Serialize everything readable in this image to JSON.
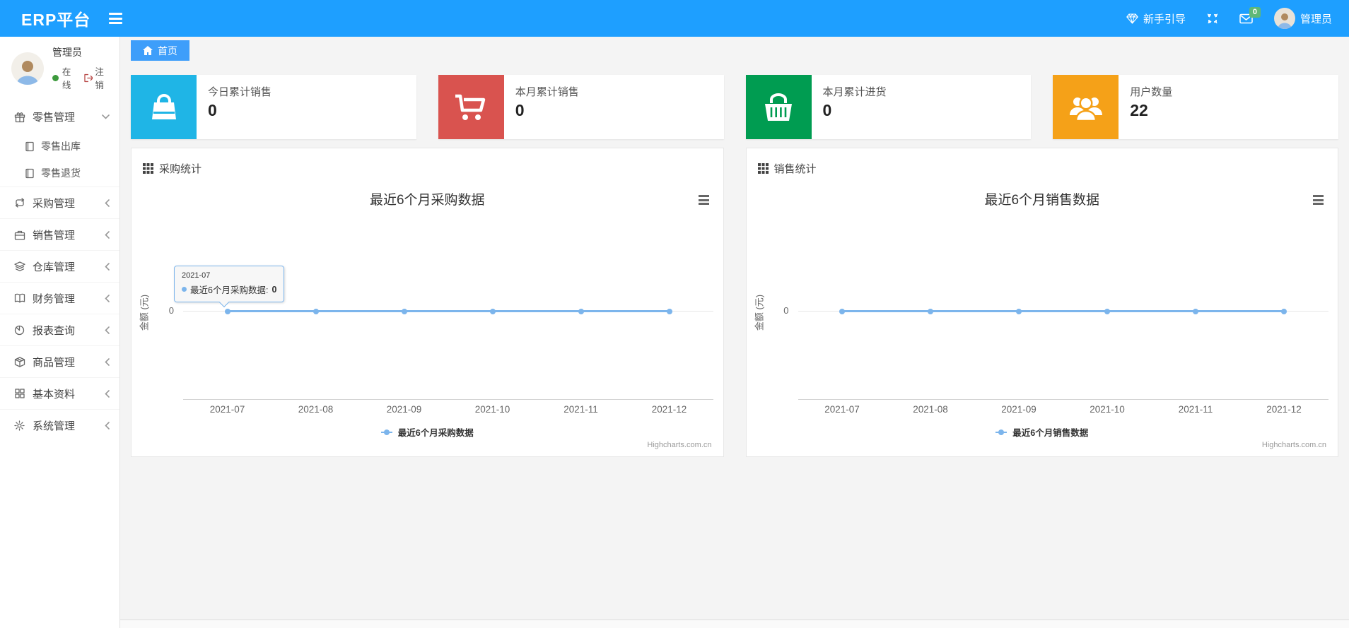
{
  "navbar": {
    "brand": "ERP平台",
    "guide_label": "新手引导",
    "message_badge": "0",
    "user_name": "管理员"
  },
  "sidebar": {
    "user": {
      "name": "管理员",
      "status": "在线",
      "logout_label": "注销"
    },
    "menu": [
      {
        "label": "零售管理",
        "icon": "gift-icon",
        "expanded": true,
        "children": [
          {
            "label": "零售出库",
            "icon": "file-icon"
          },
          {
            "label": "零售退货",
            "icon": "file-icon"
          }
        ]
      },
      {
        "label": "采购管理",
        "icon": "sync-icon"
      },
      {
        "label": "销售管理",
        "icon": "briefcase-icon"
      },
      {
        "label": "仓库管理",
        "icon": "layers-icon"
      },
      {
        "label": "财务管理",
        "icon": "ledger-icon"
      },
      {
        "label": "报表查询",
        "icon": "report-icon"
      },
      {
        "label": "商品管理",
        "icon": "box-icon"
      },
      {
        "label": "基本资料",
        "icon": "grid-icon"
      },
      {
        "label": "系统管理",
        "icon": "gear-icon"
      }
    ]
  },
  "breadcrumb": {
    "home_label": "首页"
  },
  "stat_cards": [
    {
      "label": "今日累计销售",
      "value": "0",
      "icon": "bag-icon",
      "color": "#1FB5E6"
    },
    {
      "label": "本月累计销售",
      "value": "0",
      "icon": "cart-icon",
      "color": "#D9534F"
    },
    {
      "label": "本月累计进货",
      "value": "0",
      "icon": "basket-icon",
      "color": "#009C51"
    },
    {
      "label": "用户数量",
      "value": "22",
      "icon": "users-icon",
      "color": "#F5A118"
    }
  ],
  "panels": [
    {
      "title": "采购统计"
    },
    {
      "title": "销售统计"
    }
  ],
  "chart_data": [
    {
      "type": "line",
      "title": "最近6个月采购数据",
      "categories": [
        "2021-07",
        "2021-08",
        "2021-09",
        "2021-10",
        "2021-11",
        "2021-12"
      ],
      "series": [
        {
          "name": "最近6个月采购数据",
          "values": [
            0,
            0,
            0,
            0,
            0,
            0
          ]
        }
      ],
      "xlabel": "",
      "ylabel": "金额 (元)",
      "yticks": [
        "0"
      ],
      "ylim": [
        0,
        1
      ],
      "grid": true,
      "legend_position": "bottom",
      "line_color": "#7cb5ec",
      "credits": "Highcharts.com.cn",
      "tooltip": {
        "header": "2021-07",
        "label": "最近6个月采购数据:",
        "value": "0"
      }
    },
    {
      "type": "line",
      "title": "最近6个月销售数据",
      "categories": [
        "2021-07",
        "2021-08",
        "2021-09",
        "2021-10",
        "2021-11",
        "2021-12"
      ],
      "series": [
        {
          "name": "最近6个月销售数据",
          "values": [
            0,
            0,
            0,
            0,
            0,
            0
          ]
        }
      ],
      "xlabel": "",
      "ylabel": "金额 (元)",
      "yticks": [
        "0"
      ],
      "ylim": [
        0,
        1
      ],
      "grid": true,
      "legend_position": "bottom",
      "line_color": "#7cb5ec",
      "credits": "Highcharts.com.cn"
    }
  ]
}
